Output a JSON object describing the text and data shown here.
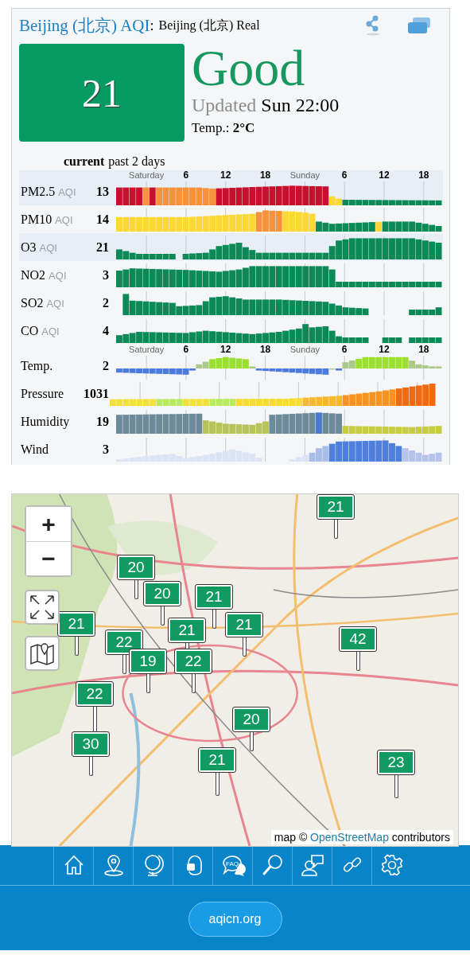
{
  "header": {
    "city": "Beijing (北京) AQI",
    "separator": ":",
    "station": "Beijing (北京) Real"
  },
  "aqi": {
    "value": "21",
    "status": "Good"
  },
  "updated": {
    "label": "Updated",
    "time": "Sun 22:00"
  },
  "temperature": {
    "label": "Temp.:",
    "value": "2°C"
  },
  "history_tabs": [
    {
      "label": "current",
      "selected": true
    },
    {
      "label": "past 2 days",
      "selected": false
    }
  ],
  "rows": [
    {
      "name": "PM2.5",
      "unit": "AQI",
      "value": "13",
      "kind": "pollutant",
      "shaded": true,
      "time_labels": [
        "Saturday",
        "6",
        "12",
        "18",
        "Sunday",
        "6",
        "12",
        "18"
      ]
    },
    {
      "name": "PM10",
      "unit": "AQI",
      "value": "14",
      "kind": "pollutant",
      "shaded": false
    },
    {
      "name": "O3",
      "unit": "AQI",
      "value": "21",
      "kind": "pollutant",
      "shaded": true
    },
    {
      "name": "NO2",
      "unit": "AQI",
      "value": "3",
      "kind": "pollutant",
      "shaded": false
    },
    {
      "name": "SO2",
      "unit": "AQI",
      "value": "2",
      "kind": "pollutant",
      "shaded": false
    },
    {
      "name": "CO",
      "unit": "AQI",
      "value": "4",
      "kind": "pollutant",
      "shaded": false
    },
    {
      "name": "Temp.",
      "value": "2",
      "kind": "temperature",
      "shaded": false,
      "time_labels": [
        "Saturday",
        "6",
        "12",
        "18",
        "Sunday",
        "6",
        "12",
        "18"
      ]
    },
    {
      "name": "Pressure",
      "value": "1031",
      "kind": "pressure",
      "shaded": false
    },
    {
      "name": "Humidity",
      "value": "19",
      "kind": "humidity",
      "shaded": false
    },
    {
      "name": "Wind",
      "value": "3",
      "kind": "wind",
      "shaded": false
    }
  ],
  "map": {
    "zoom_in": "+",
    "zoom_out": "−",
    "markers": [
      {
        "value": "21"
      },
      {
        "value": "20"
      },
      {
        "value": "20"
      },
      {
        "value": "21"
      },
      {
        "value": "21"
      },
      {
        "value": "22"
      },
      {
        "value": "21"
      },
      {
        "value": "21"
      },
      {
        "value": "19"
      },
      {
        "value": "22"
      },
      {
        "value": "42"
      },
      {
        "value": "22"
      },
      {
        "value": "20"
      },
      {
        "value": "30"
      },
      {
        "value": "21"
      },
      {
        "value": "23"
      }
    ],
    "attribution": {
      "prefix": "map ©",
      "link": "OpenStreetMap",
      "suffix": "contributors"
    }
  },
  "nav": {
    "faq_label": "FAQ"
  },
  "footer": {
    "link": "aqicn.org"
  }
}
